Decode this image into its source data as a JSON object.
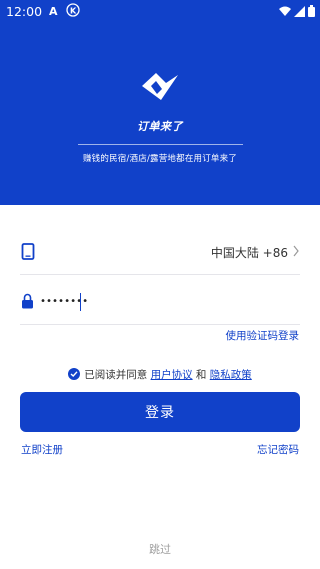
{
  "status_bar": {
    "time": "12:00",
    "icons": [
      "a-notification-icon",
      "k-notification-icon",
      "wifi-icon",
      "signal-icon",
      "battery-icon"
    ]
  },
  "brand": {
    "name": "订单来了",
    "slogan": "赚钱的民宿/酒店/露营地都在用订单来了"
  },
  "phone_field": {
    "icon": "phone-icon",
    "region": "中国大陆 +86"
  },
  "password_field": {
    "icon": "lock-icon",
    "value": "••••••••"
  },
  "links": {
    "sms_login": "使用验证码登录",
    "register": "立即注册",
    "forgot_password": "忘记密码",
    "skip": "跳过"
  },
  "agreement": {
    "prefix": "已阅读并同意",
    "user_agreement": "用户协议",
    "and": "和",
    "privacy_policy": "隐私政策",
    "checked": true
  },
  "login_button": {
    "label": "登录"
  },
  "colors": {
    "primary": "#1141c9",
    "background": "#ffffff",
    "divider": "#e5e5ea",
    "muted_text": "#a0a0a0"
  }
}
